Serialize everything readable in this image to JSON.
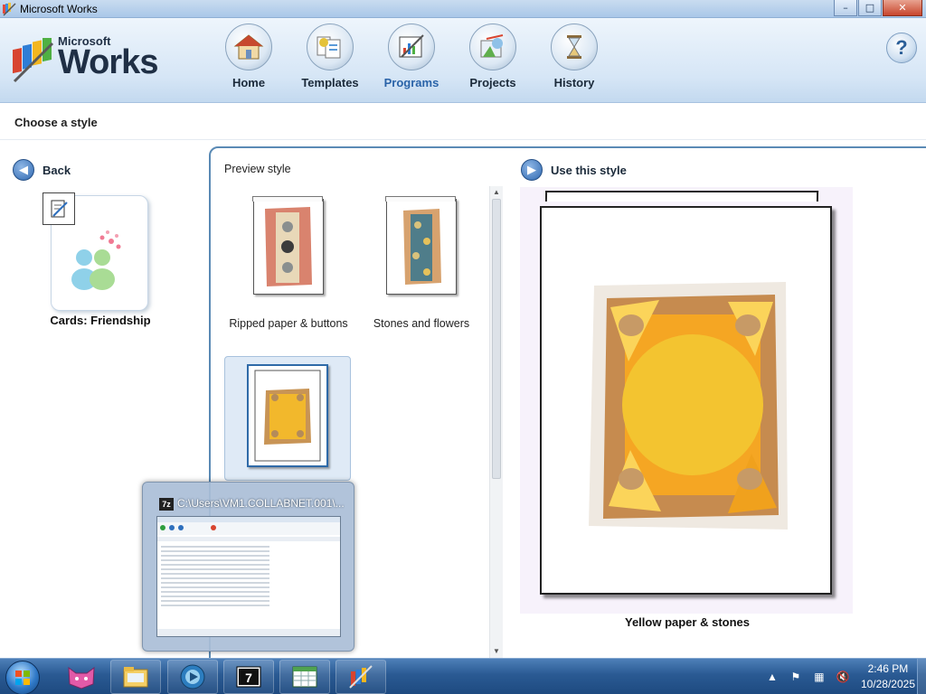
{
  "window": {
    "title": "Microsoft Works",
    "controls": {
      "minimize": "–",
      "maximize": "□",
      "close": "✕"
    }
  },
  "header": {
    "brand_small": "Microsoft",
    "brand_big": "Works",
    "nav": [
      {
        "label": "Home",
        "icon": "house-icon"
      },
      {
        "label": "Templates",
        "icon": "templates-icon"
      },
      {
        "label": "Programs",
        "icon": "programs-icon",
        "active": true
      },
      {
        "label": "Projects",
        "icon": "projects-icon"
      },
      {
        "label": "History",
        "icon": "hourglass-icon"
      }
    ],
    "help_label": "?"
  },
  "subheader": {
    "title": "Choose a style"
  },
  "left": {
    "back_label": "Back",
    "project_label": "Cards: Friendship"
  },
  "center": {
    "preview_label": "Preview style",
    "styles": [
      {
        "label": "Ripped paper & buttons"
      },
      {
        "label": "Stones and flowers"
      },
      {
        "label": "Yellow paper & stones",
        "selected": true
      }
    ]
  },
  "right": {
    "use_label": "Use this style",
    "selected_label": "Yellow paper & stones"
  },
  "taskbar_preview": {
    "icon_text": "7z",
    "title": "C:\\Users\\VM1.COLLABNET.001\\..."
  },
  "tray": {
    "time": "2:46 PM",
    "date": "10/28/2025"
  },
  "colors": {
    "accent": "#2a63a8",
    "panel_border": "#5a8ab5",
    "taskbar": "#2a5a93"
  }
}
